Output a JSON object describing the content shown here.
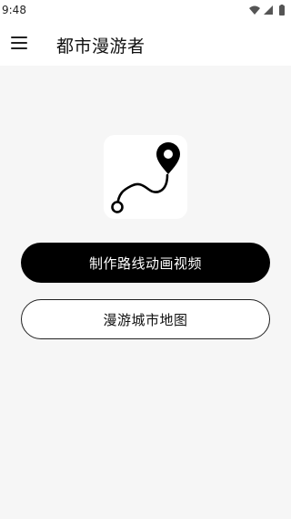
{
  "status_bar": {
    "time": "9:48",
    "icons": [
      "wifi-icon",
      "signal-icon",
      "battery-icon"
    ]
  },
  "app_bar": {
    "menu_icon": "menu-icon",
    "title": "都市漫游者"
  },
  "main": {
    "logo_icon": "route-pin-icon",
    "primary_button_label": "制作路线动画视频",
    "secondary_button_label": "漫游城市地图"
  },
  "colors": {
    "background": "#f6f6f6",
    "primary_button_bg": "#000000",
    "primary_button_text": "#ffffff",
    "secondary_button_bg": "#ffffff",
    "secondary_button_border": "#222222"
  }
}
